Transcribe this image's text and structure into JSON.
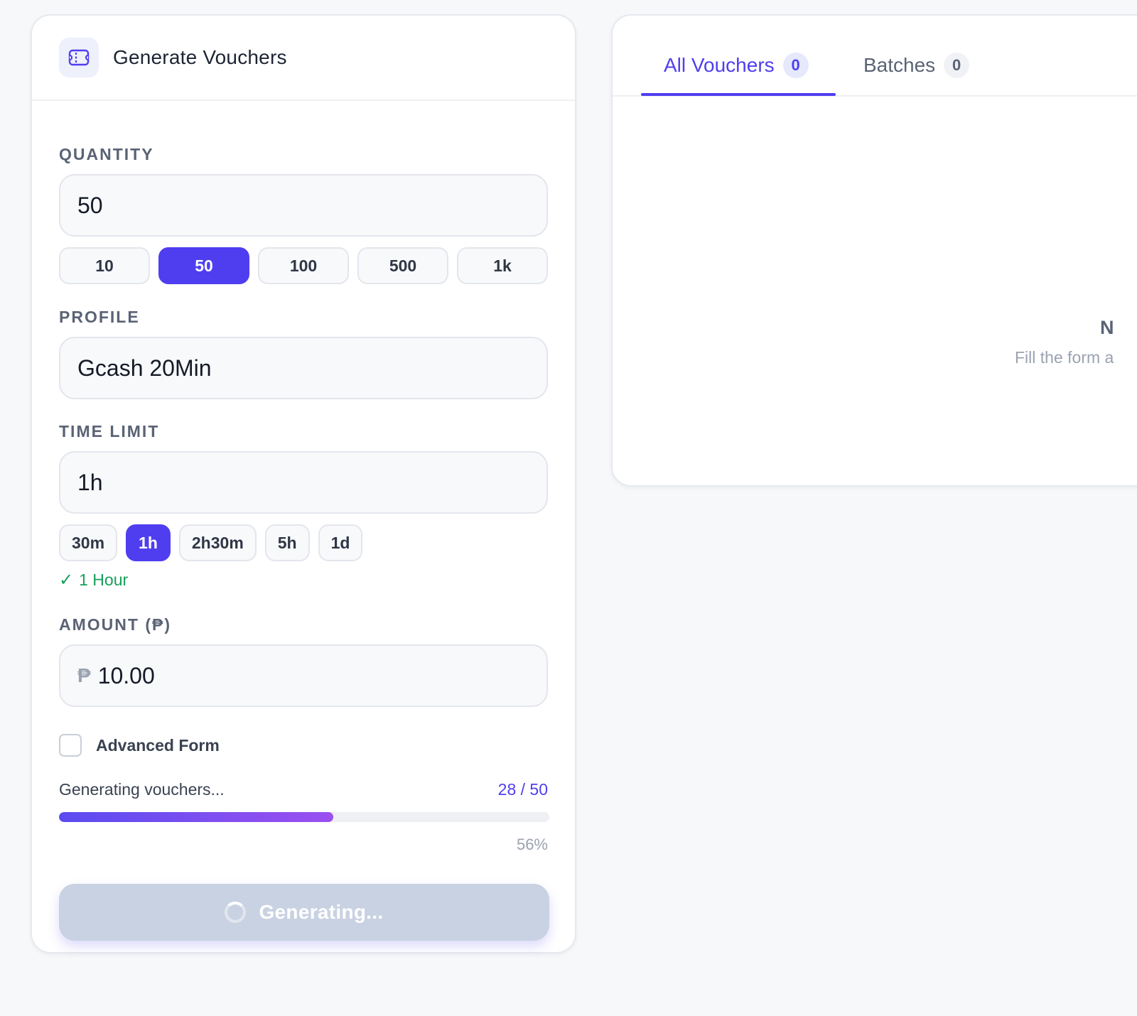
{
  "generator": {
    "title": "Generate Vouchers",
    "icon": "ticket-icon",
    "quantity": {
      "label": "QUANTITY",
      "value": "50",
      "presets": [
        "10",
        "50",
        "100",
        "500",
        "1k"
      ],
      "selected": "50"
    },
    "profile": {
      "label": "PROFILE",
      "value": "Gcash 20Min"
    },
    "time_limit": {
      "label": "TIME LIMIT",
      "value": "1h",
      "presets": [
        "30m",
        "1h",
        "2h30m",
        "5h",
        "1d"
      ],
      "selected": "1h",
      "hint": "1 Hour",
      "hint_icon": "check-icon"
    },
    "amount": {
      "label": "AMOUNT (₱)",
      "currency_symbol": "₱",
      "value": "10.00"
    },
    "advanced": {
      "label": "Advanced Form",
      "checked": false
    },
    "progress": {
      "text": "Generating vouchers...",
      "count": "28 / 50",
      "fraction": 0.56,
      "percent_label": "56%"
    },
    "button": {
      "label": "Generating...",
      "state": "disabled-loading"
    }
  },
  "vouchers_panel": {
    "tabs": [
      {
        "label": "All Vouchers",
        "count": "0",
        "active": true
      },
      {
        "label": "Batches",
        "count": "0",
        "active": false
      }
    ],
    "empty_title": "N",
    "empty_subtitle": "Fill the form a"
  },
  "colors": {
    "accent": "#4f3ef0",
    "success": "#16a05a",
    "progress_gradient_start": "#5a4cf0",
    "progress_gradient_end": "#9b4ff0",
    "button_disabled": "#c9d2e2"
  }
}
